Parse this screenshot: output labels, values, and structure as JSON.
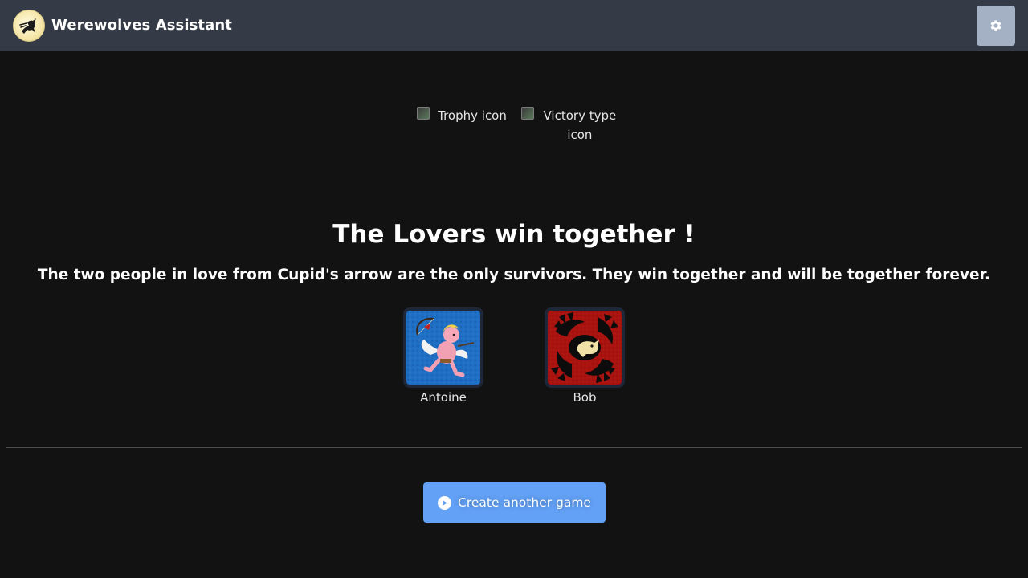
{
  "header": {
    "app_title": "Werewolves Assistant",
    "logo_icon": "werewolf-logo-icon",
    "settings_icon": "gear-icon"
  },
  "result": {
    "trophy_alt": "Trophy icon",
    "victory_type_alt": "Victory type icon",
    "title": "The Lovers win together !",
    "description": "The two people in love from Cupid's arrow are the only survivors. They win together and will be together forever."
  },
  "winners": [
    {
      "name": "Antoine",
      "role_icon": "cupid-role-icon"
    },
    {
      "name": "Bob",
      "role_icon": "werewolf-role-icon"
    }
  ],
  "actions": {
    "create_game_label": "Create another game",
    "create_game_icon": "play-circle-icon"
  },
  "colors": {
    "background": "#121212",
    "navbar": "#343a46",
    "primary_button": "#62a1f6",
    "settings_button": "#a4b1c4"
  }
}
